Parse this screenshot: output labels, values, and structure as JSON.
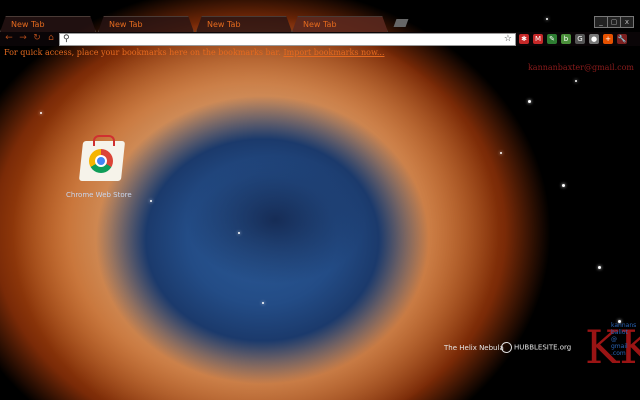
{
  "window": {
    "tabs": [
      {
        "label": "New Tab"
      },
      {
        "label": "New Tab"
      },
      {
        "label": "New Tab"
      },
      {
        "label": "New Tab"
      }
    ],
    "controls": {
      "minimize": "_",
      "maximize": "▢",
      "close": "x"
    }
  },
  "toolbar": {
    "back_icon": "back-arrow-icon",
    "forward_icon": "forward-arrow-icon",
    "reload_icon": "reload-icon",
    "home_icon": "home-icon",
    "omnibox": {
      "value": "",
      "placeholder": ""
    },
    "extensions": [
      {
        "name": "asterisk-ext-icon",
        "color": "#c62828",
        "glyph": "✱"
      },
      {
        "name": "gmail-ext-icon",
        "color": "#c62828",
        "glyph": "M"
      },
      {
        "name": "green-ext-icon",
        "color": "#2e7d32",
        "glyph": "✎"
      },
      {
        "name": "docs-ext-icon",
        "color": "#4a8f3a",
        "glyph": "b"
      },
      {
        "name": "google-ext-icon",
        "color": "#555555",
        "glyph": "G"
      },
      {
        "name": "globe-ext-icon",
        "color": "#777777",
        "glyph": "●"
      },
      {
        "name": "plus-ext-icon",
        "color": "#e65100",
        "glyph": "+"
      },
      {
        "name": "wrench-icon",
        "color": "#7a1f1f",
        "glyph": "🔧"
      }
    ]
  },
  "bookmarks_bar": {
    "message": "For quick access, place your bookmarks here on the bookmarks bar.",
    "link": "Import bookmarks now..."
  },
  "user": {
    "label": "kannanbaxter@gmail.com"
  },
  "apps": [
    {
      "label": "Chrome Web Store"
    }
  ],
  "theme": {
    "caption": "The Helix Nebula",
    "credit": "HUBBLESITE.org",
    "watermark_letters": "KK",
    "watermark_lines": [
      "kannans",
      "ballot",
      "@",
      "gmail",
      ".com"
    ],
    "accent_color": "#e56a1f",
    "watermark_color": "#9a1414"
  }
}
